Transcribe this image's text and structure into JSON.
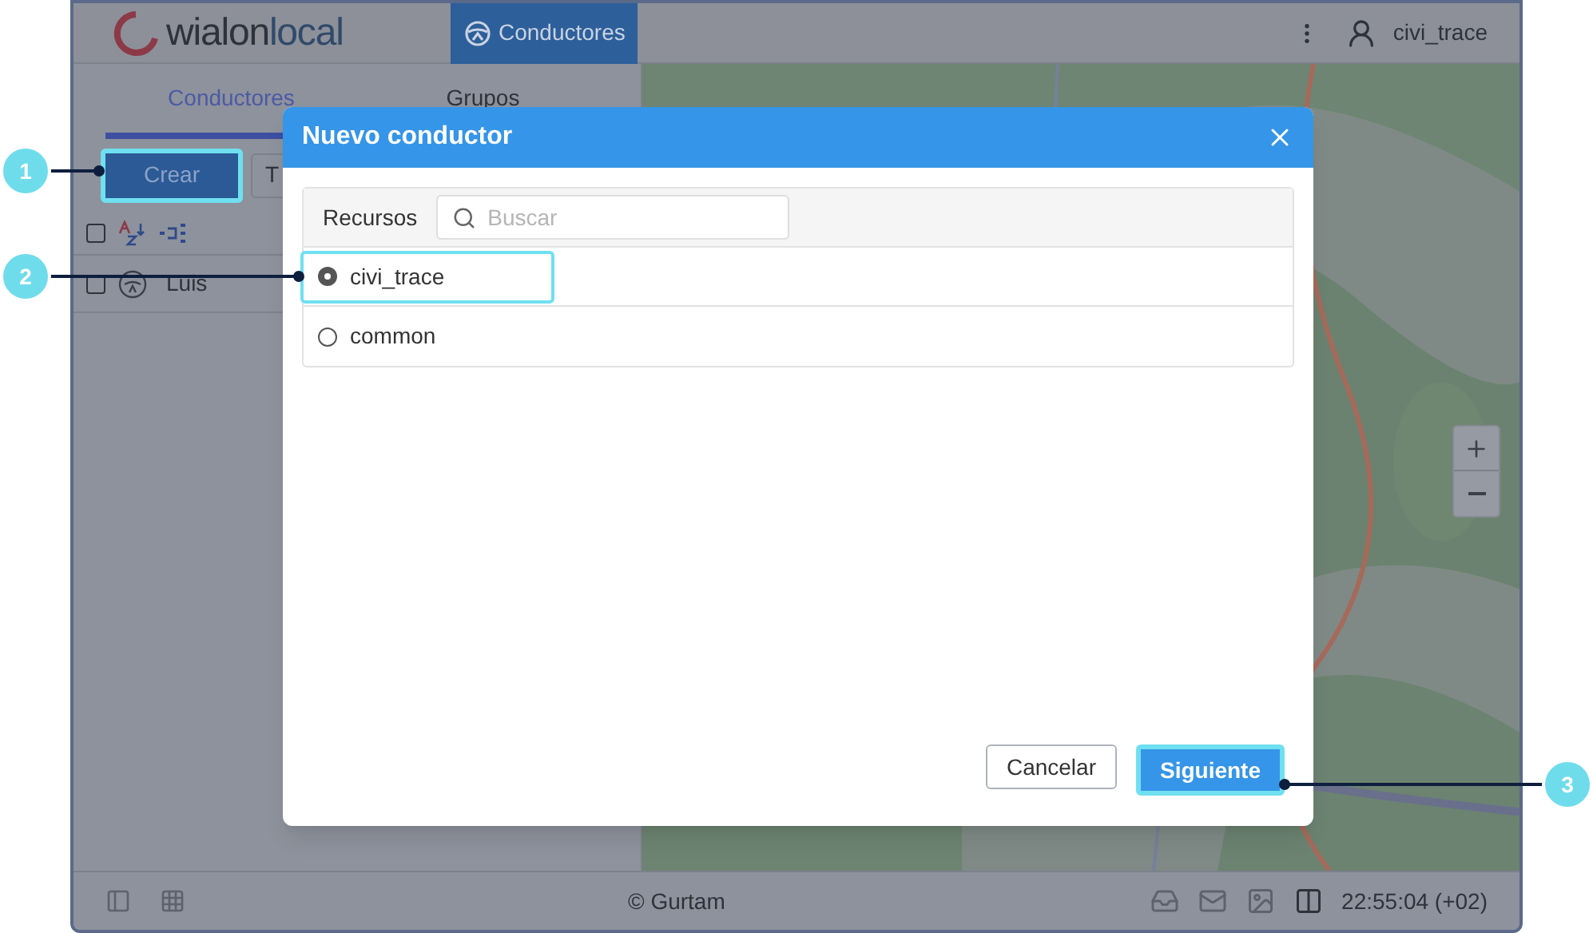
{
  "header": {
    "logo": {
      "part_1": "wialon",
      "part_2": "local"
    },
    "module_tab": "Conductores",
    "user": "civi_trace"
  },
  "left_panel": {
    "tabs": [
      {
        "label": "Conductores",
        "selected": true
      },
      {
        "label": "Grupos",
        "selected": false
      }
    ],
    "create_button": {
      "label": "Crear",
      "highlighted": true
    },
    "second_button": "T",
    "select_all": {
      "checked": false
    },
    "drivers": [
      {
        "name": "Luis",
        "checked": false
      }
    ]
  },
  "footer": {
    "copyright": "© Gurtam",
    "time": "22:55:04 (+02)"
  },
  "dialog": {
    "title": "Nuevo conductor",
    "column_label": "Recursos",
    "search": {
      "placeholder": "Buscar"
    },
    "resources": [
      {
        "name": "civi_trace",
        "selected": true,
        "highlighted": true
      },
      {
        "name": "common",
        "selected": false,
        "highlighted": false
      }
    ],
    "buttons": [
      {
        "label": "Cancelar",
        "kind": "secondary",
        "highlighted": false
      },
      {
        "label": "Siguiente",
        "kind": "primary",
        "highlighted": true
      }
    ]
  },
  "callouts": [
    {
      "number": "1"
    },
    {
      "number": "2"
    },
    {
      "number": "3"
    }
  ]
}
